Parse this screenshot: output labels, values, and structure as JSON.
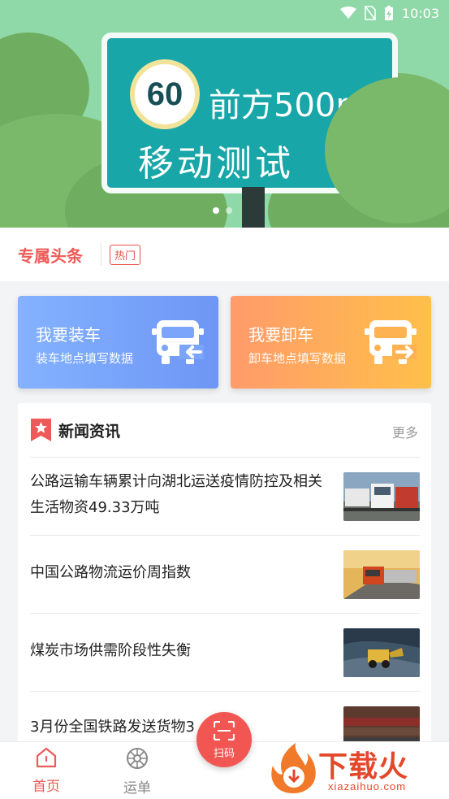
{
  "status_bar": {
    "time": "10:03"
  },
  "banner": {
    "speed_limit": "60",
    "sign_line1": "前方500m",
    "sign_line2": "移动测试",
    "slide_count": 2,
    "active_slide": 1
  },
  "headline": {
    "title": "专属头条",
    "badge": "热门"
  },
  "actions": {
    "load": {
      "title": "我要装车",
      "subtitle": "装车地点填写数据"
    },
    "unload": {
      "title": "我要卸车",
      "subtitle": "卸车地点填写数据"
    }
  },
  "news": {
    "title": "新闻资讯",
    "more": "更多",
    "items": [
      {
        "text": "公路运输车辆累计向湖北运送疫情防控及相关生活物资49.33万吨",
        "thumb": "trucks-photo"
      },
      {
        "text": "中国公路物流运价周指数",
        "thumb": "orange-truck-photo"
      },
      {
        "text": "煤炭市场供需阶段性失衡",
        "thumb": "coal-loader-photo"
      },
      {
        "text": "3月份全国铁路发送货物3",
        "thumb": "freight-train-photo"
      }
    ]
  },
  "nav": {
    "home": "首页",
    "orders": "运单",
    "scan": "扫码"
  },
  "watermark": {
    "main": "下载火",
    "sub": "xiazaihuo.com"
  },
  "colors": {
    "accent": "#ee5a57",
    "load_card": "#7aa5fb",
    "unload_card": "#ffae5a",
    "banner_bg": "#8fd8a8",
    "sign": "#18a6a8"
  }
}
